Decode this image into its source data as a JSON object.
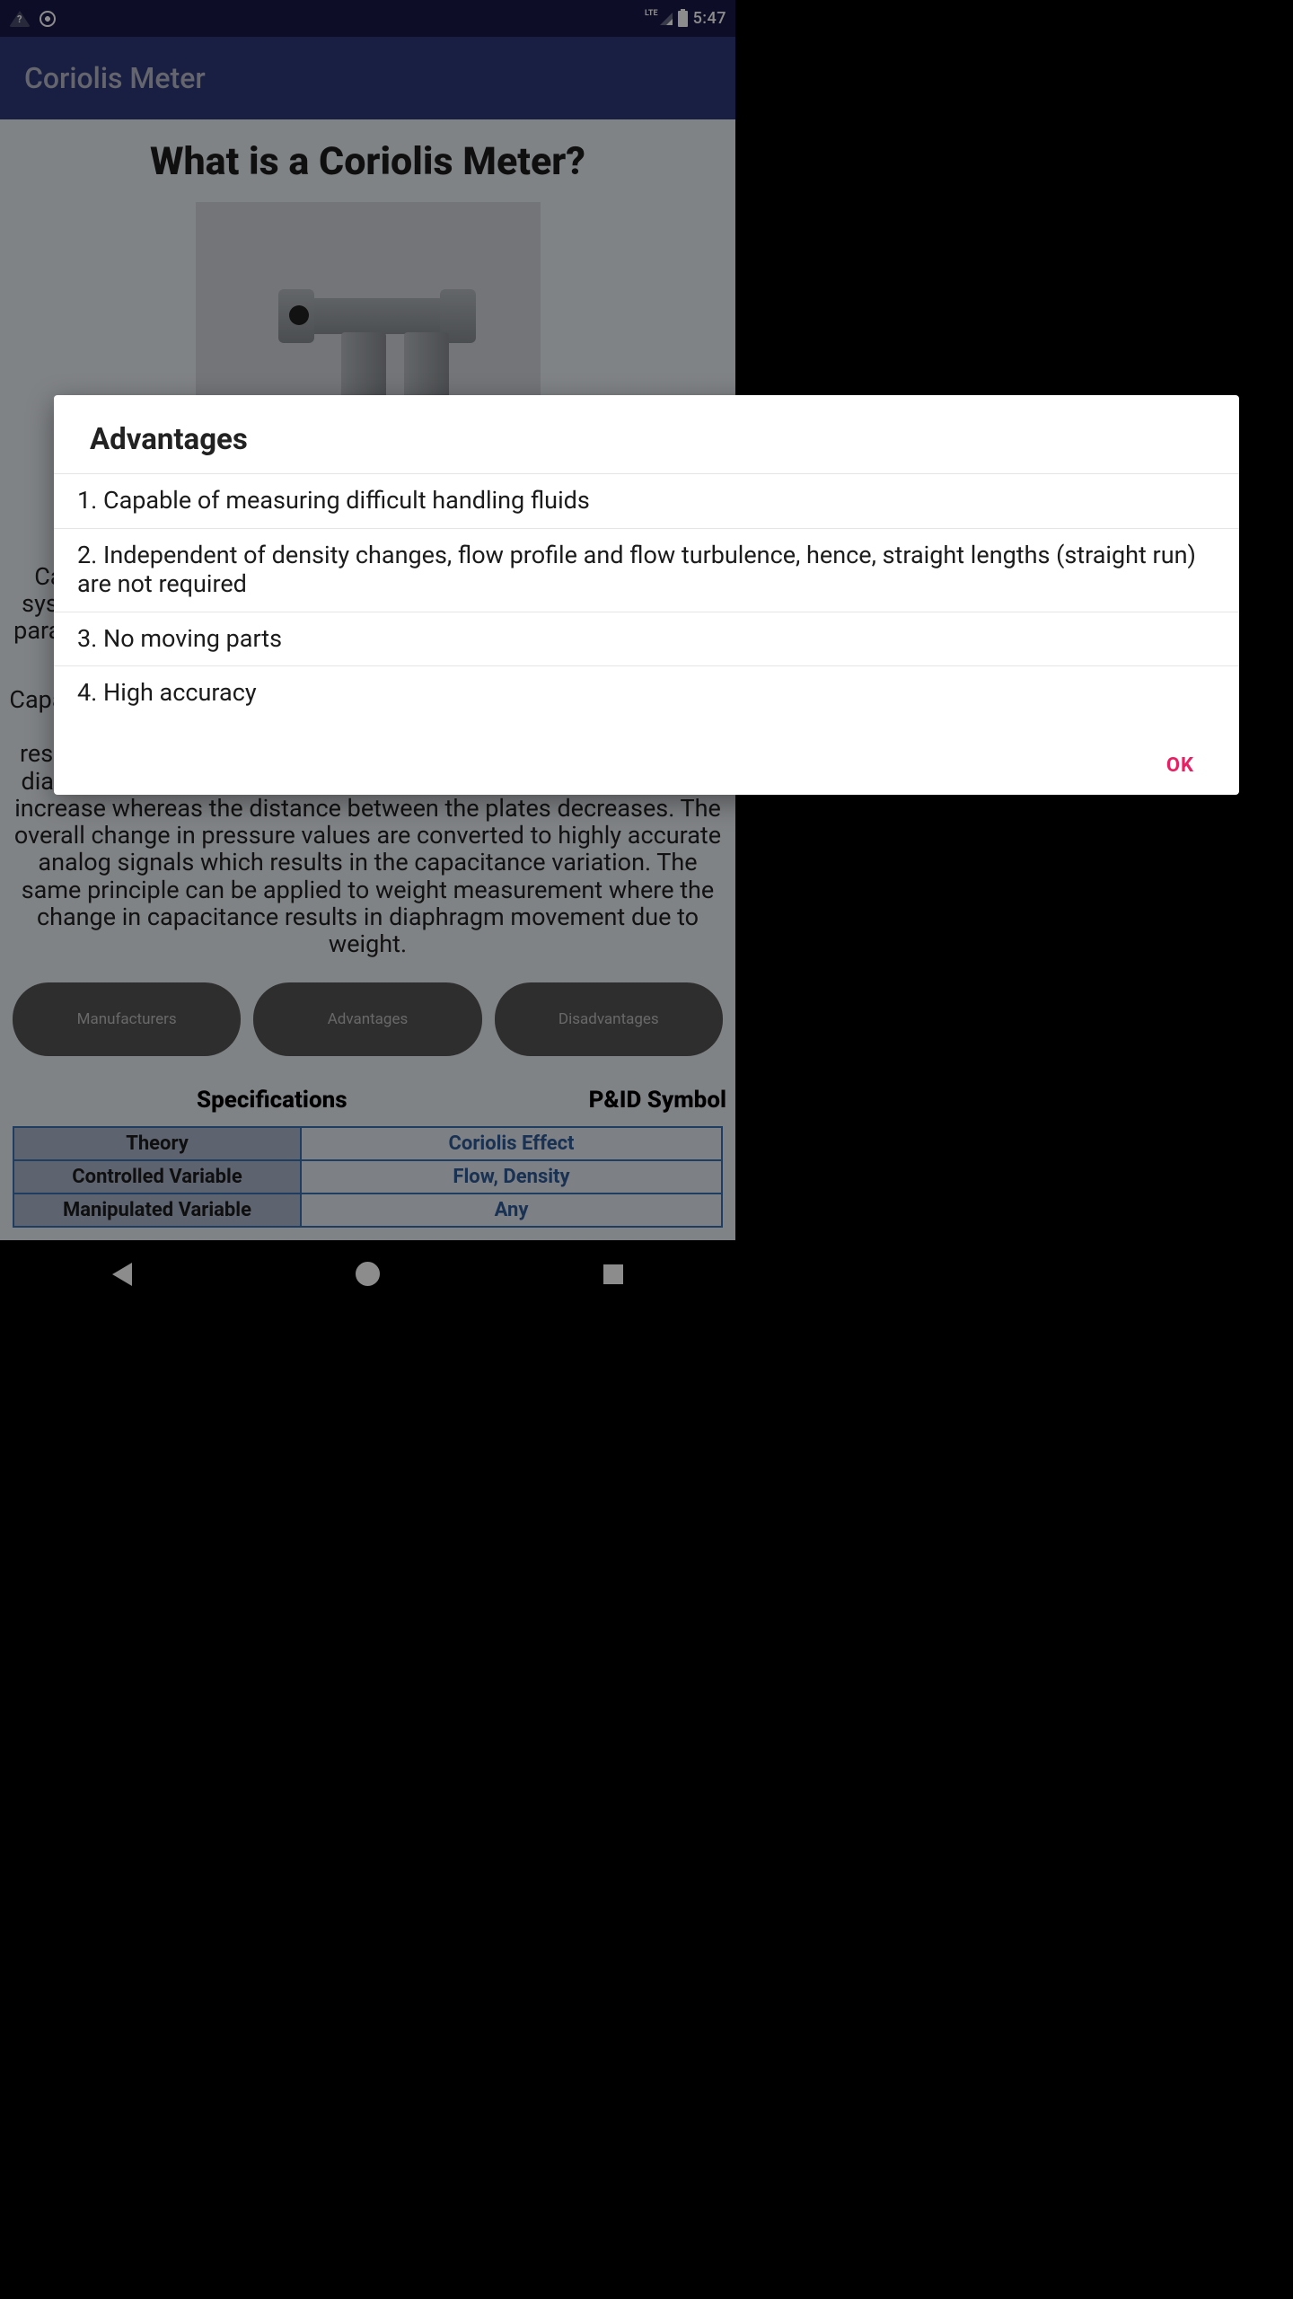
{
  "status": {
    "lte": "LTE",
    "time": "5:47"
  },
  "appbar": {
    "title": "Coriolis Meter"
  },
  "page": {
    "title": "What is a Coriolis Meter?",
    "para1": "Capacitance pressure transducers rely on a flexural element, a system tolerance capacitor, and a capacitor with closely coupled parallel circular plates with the intent of being able to measure the total capacitance.",
    "para2": "Capacitance of closely spaced parallel plates relates to the change in capacitance thus the gap between the plates changes in response to pressure. If pressure is applied to the transducer, the diaphragm will be caused to deflect. Hence, one capacitance will increase whereas the distance between the plates decreases. The overall change in pressure values are converted to highly accurate analog signals which results in the capacitance variation. The same principle can be applied to weight measurement where the change in capacitance results in diaphragm movement due to weight."
  },
  "pills": {
    "a": "Manufacturers",
    "b": "Advantages",
    "c": "Disadvantages"
  },
  "spec": {
    "heading1": "Specifications",
    "heading2": "P&ID Symbol",
    "rows": [
      {
        "k": "Theory",
        "v": "Coriolis Effect"
      },
      {
        "k": "Controlled Variable",
        "v": "Flow, Density"
      },
      {
        "k": "Manipulated Variable",
        "v": "Any"
      }
    ]
  },
  "dialog": {
    "title": "Advantages",
    "items": [
      "1. Capable of measuring difficult handling fluids",
      "2. Independent of density changes, flow profile and flow turbulence, hence, straight lengths (straight run) are not required",
      "3. No moving parts",
      "4. High accuracy"
    ],
    "ok": "OK"
  }
}
